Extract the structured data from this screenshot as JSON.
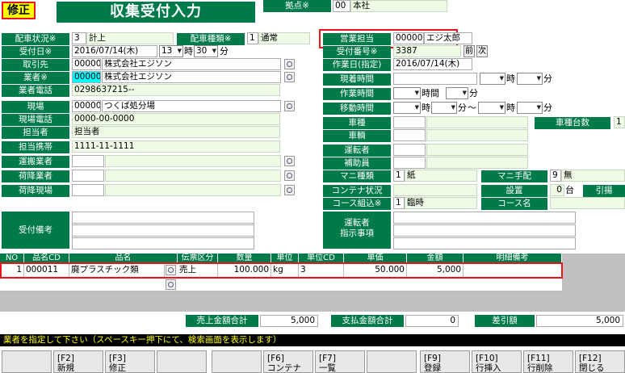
{
  "header": {
    "mode": "修正",
    "title": "収集受付入力",
    "base_label": "拠点※",
    "base_code": "00",
    "base_name": "本社"
  },
  "left": {
    "status_label": "配車状況※",
    "status_code": "3",
    "status_name": "計上",
    "dispatch_type_label": "配車種類※",
    "dispatch_type_code": "1",
    "dispatch_type_name": "通常",
    "date_label": "受付日※",
    "date_value": "2016/07/14(木)",
    "hour": "13",
    "hour_unit": "時",
    "minute": "30",
    "minute_unit": "分",
    "client_label": "取引先",
    "client_code": "000000",
    "client_name": "株式会社エジソン",
    "vendor_label": "業者※",
    "vendor_code": "000000",
    "vendor_name": "株式会社エジソン",
    "vendor_phone_label": "業者電話",
    "vendor_phone": "0298637215--",
    "site_label": "現場",
    "site_code": "000001",
    "site_name": "つくば処分場",
    "site_phone_label": "現場電話",
    "site_phone": "0000-00-0000",
    "person_label": "担当者",
    "person_value": "担当者",
    "mobile_label": "担当携帯",
    "mobile_value": "1111-11-1111",
    "carrier_label": "運搬業者",
    "unload_vendor_label": "荷降業者",
    "unload_site_label": "荷降現場",
    "remarks_label": "受付備考"
  },
  "right": {
    "sales_label": "営業担当",
    "sales_code": "000001",
    "sales_name": "エジ太郎",
    "receipt_label": "受付番号※",
    "receipt_no": "3387",
    "prev_button": "前",
    "next_button": "次",
    "work_date_label": "作業日(指定)",
    "work_date": "2016/07/14(木)",
    "arrival_label": "現着時間",
    "work_time_label": "作業時間",
    "move_time_label": "移動時間",
    "hour_unit": "時",
    "minute_unit": "分",
    "tilde": "～",
    "time_unit": "時間",
    "vehicle_type_label": "車種",
    "vehicle_count_label": "車種台数",
    "vehicle_count": "1",
    "vehicle_label": "車輌",
    "driver_label": "運転者",
    "assistant_label": "補助員",
    "manifest_type_label": "マニ種類",
    "manifest_type_code": "1",
    "manifest_type_name": "紙",
    "manifest_arrange_label": "マニ手配",
    "manifest_arrange_code": "9",
    "manifest_arrange_name": "無",
    "container_label": "コンテナ状況",
    "install_label": "設置",
    "install_value": "0",
    "install_unit": "台",
    "pull_label": "引揚",
    "course_label": "コース組込※",
    "course_code": "1",
    "course_name": "臨時",
    "course_name_label": "コース名",
    "driver_notes_label1": "運転者",
    "driver_notes_label2": "指示事項"
  },
  "grid": {
    "columns": [
      "NO",
      "品名CD",
      "品名",
      "伝票区分",
      "数量",
      "単位",
      "単位CD",
      "単価",
      "金額",
      "明細備考"
    ],
    "rows": [
      {
        "no": "1",
        "item_cd": "000011",
        "item": "廃プラスチック類",
        "slip_type": "売上",
        "qty": "100.000",
        "unit": "kg",
        "unit_cd": "3",
        "price": "50.000",
        "amount": "5,000",
        "memo": ""
      }
    ]
  },
  "totals": {
    "sales_label": "売上金額合計",
    "sales_value": "5,000",
    "pay_label": "支払金額合計",
    "pay_value": "0",
    "diff_label": "差引額",
    "diff_value": "5,000"
  },
  "status_message": "業者を指定して下さい（スペースキー押下にて、検索画面を表示します）",
  "fkeys": [
    {
      "key": "",
      "label": ""
    },
    {
      "key": "[F2]",
      "label": "新規"
    },
    {
      "key": "[F3]",
      "label": "修正"
    },
    {
      "key": "",
      "label": ""
    },
    {
      "key": "",
      "label": ""
    },
    {
      "key": "[F6]",
      "label": "コンテナ"
    },
    {
      "key": "[F7]",
      "label": "一覧"
    },
    {
      "key": "",
      "label": ""
    },
    {
      "key": "[F9]",
      "label": "登録"
    },
    {
      "key": "[F10]",
      "label": "行挿入"
    },
    {
      "key": "[F11]",
      "label": "行削除"
    },
    {
      "key": "[F12]",
      "label": "閉じる"
    }
  ],
  "colors": {
    "green": "#007a48",
    "readonly": "#f0fbe7",
    "highlight_cyan": "#00ffff",
    "red": "#e8151b",
    "mode_yellow": "#ffff00"
  }
}
